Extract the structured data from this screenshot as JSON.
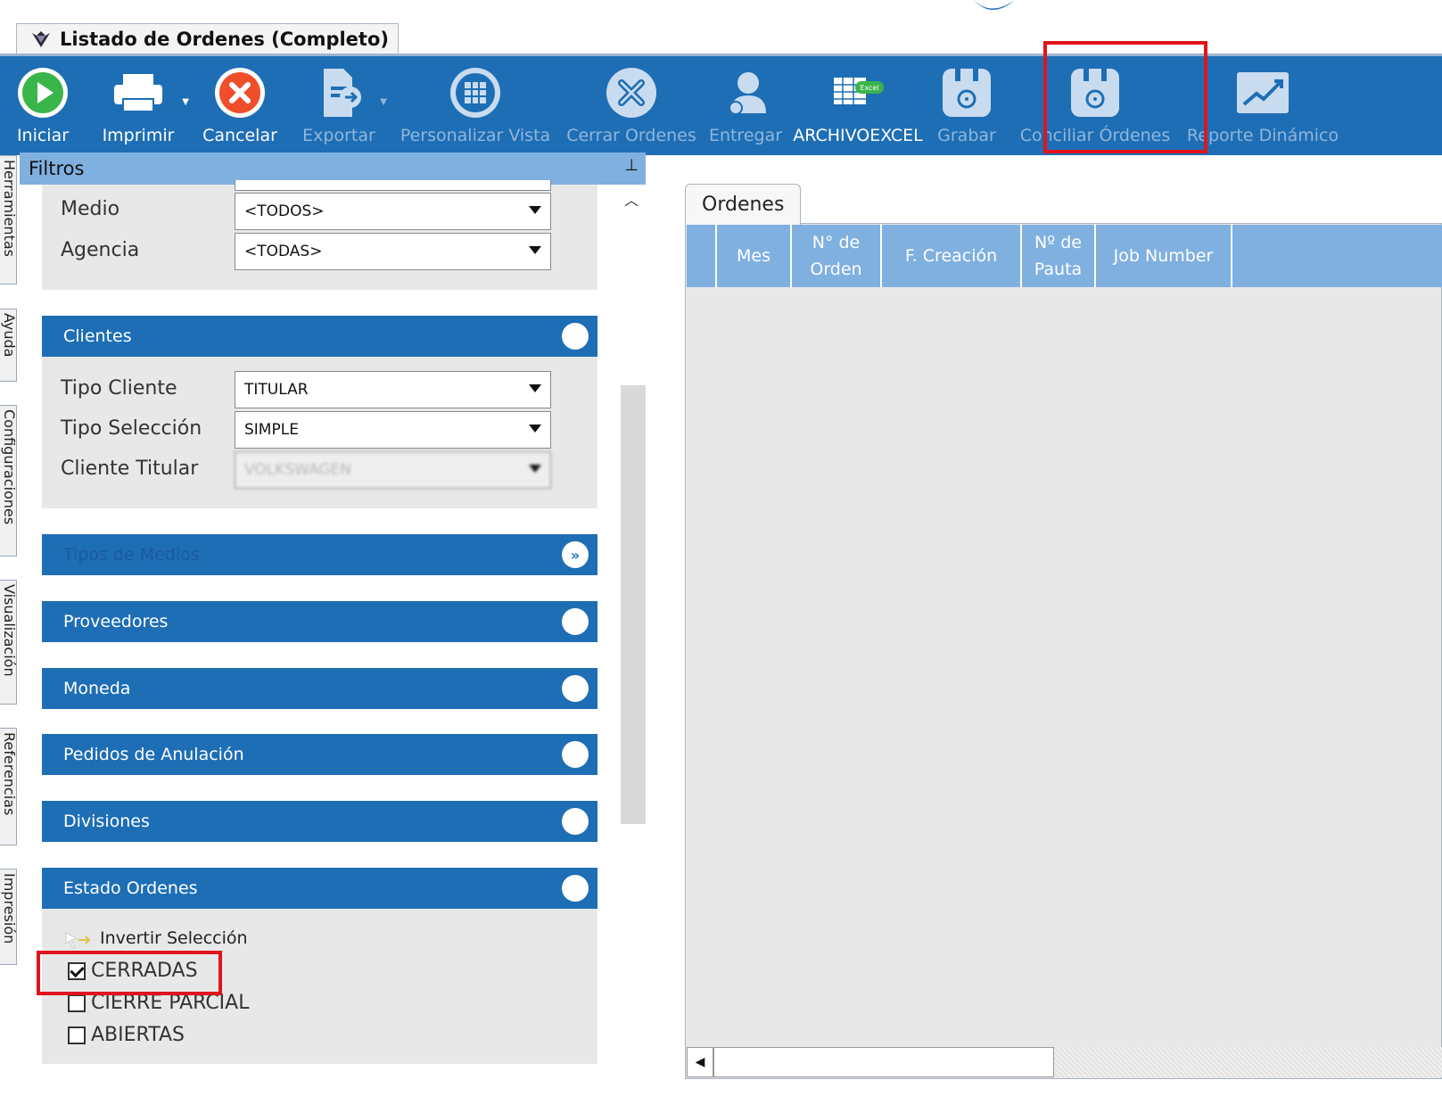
{
  "window": {
    "tab_title": "Listado de Ordenes (Completo)"
  },
  "toolbar": {
    "buttons": [
      {
        "label": "Iniciar",
        "icon": "play-icon",
        "enabled": true
      },
      {
        "label": "Imprimir",
        "icon": "printer-icon",
        "enabled": true
      },
      {
        "label": "Cancelar",
        "icon": "cancel-icon",
        "enabled": true
      },
      {
        "label": "Exportar",
        "icon": "export-icon",
        "enabled": false
      },
      {
        "label": "Personalizar Vista",
        "icon": "grid-view-icon",
        "enabled": false
      },
      {
        "label": "Cerrar Ordenes",
        "icon": "close-orders-icon",
        "enabled": false
      },
      {
        "label": "Entregar",
        "icon": "user-deliver-icon",
        "enabled": false
      },
      {
        "label": "ARCHIVOEXCEL",
        "icon": "excel-file-icon",
        "enabled": true,
        "badge": "Excel"
      },
      {
        "label": "Grabar",
        "icon": "save-disk-icon",
        "enabled": false
      },
      {
        "label": "Conciliar Órdenes",
        "icon": "save-disk-icon",
        "enabled": false
      },
      {
        "label": "Reporte Dinámico",
        "icon": "trend-chart-icon",
        "enabled": false
      }
    ]
  },
  "side_tabs": [
    "Herramientas",
    "Ayuda",
    "Configuraciones",
    "Visualización",
    "Referencias",
    "Impresión"
  ],
  "filters": {
    "title": "Filtros",
    "pin_icon": "pin-icon",
    "fields_top": [
      {
        "label": "Medio",
        "value": "<TODOS>"
      },
      {
        "label": "Agencia",
        "value": "<TODAS>"
      }
    ],
    "clientes": {
      "title": "Clientes",
      "fields": [
        {
          "label": "Tipo Cliente",
          "value": "TITULAR"
        },
        {
          "label": "Tipo Selección",
          "value": "SIMPLE"
        },
        {
          "label": "Cliente Titular",
          "value": "VOLKSWAGEN"
        }
      ]
    },
    "sections": [
      {
        "title": "Tipos de Medios",
        "expand_icon": "expand-chevron-icon"
      },
      {
        "title": "Proveedores"
      },
      {
        "title": "Moneda"
      },
      {
        "title": "Pedidos de Anulación"
      },
      {
        "title": "Divisiones"
      }
    ],
    "estado": {
      "title": "Estado Ordenes",
      "invert_label": "Invertir Selección",
      "options": [
        {
          "label": "CERRADAS",
          "checked": true
        },
        {
          "label": "CIERRE PARCIAL",
          "checked": false
        },
        {
          "label": "ABIERTAS",
          "checked": false
        }
      ]
    }
  },
  "grid": {
    "tab": "Ordenes",
    "columns": [
      "Mes",
      "N° de Orden",
      "F. Creación",
      "Nº de Pauta",
      "Job Number"
    ]
  },
  "colors": {
    "toolbar_bg": "#1e6eb5",
    "header_bg": "#7fb0e0",
    "highlight": "#e0141c"
  }
}
